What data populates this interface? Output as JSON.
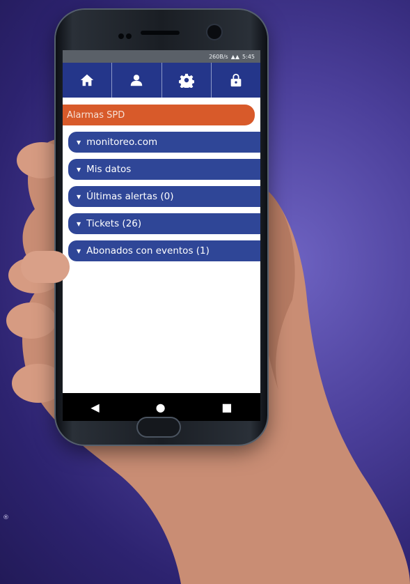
{
  "status": {
    "left": "260B/s",
    "time": "5:45"
  },
  "nav": [
    {
      "icon": "home-icon"
    },
    {
      "icon": "user-icon"
    },
    {
      "icon": "gear-icon"
    },
    {
      "icon": "lock-icon"
    }
  ],
  "header": {
    "title": "Alarmas SPD"
  },
  "menu": {
    "items": [
      {
        "label": "monitoreo.com"
      },
      {
        "label": "Mis datos"
      },
      {
        "label": "Últimas alertas (0)"
      },
      {
        "label": "Tickets (26)"
      },
      {
        "label": "Abonados con eventos (1)"
      }
    ]
  },
  "footer": {
    "registered_mark": "®"
  },
  "colors": {
    "nav_bg": "#24368a",
    "title_bg": "#d85a2a",
    "item_bg": "#2f4697",
    "background": "#4b3f9a"
  }
}
